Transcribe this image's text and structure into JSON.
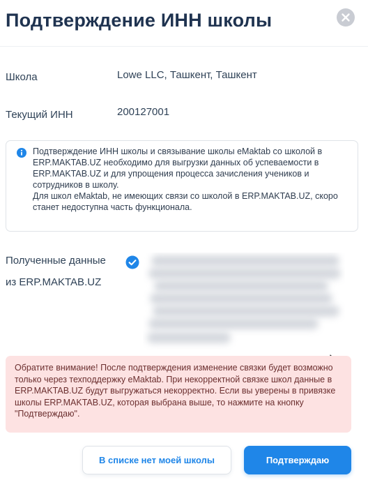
{
  "dialog": {
    "title": "Подтверждение ИНН школы",
    "close_icon": "close-icon"
  },
  "fields": {
    "school": {
      "label": "Школа",
      "value": "Lowe LLC, Ташкент, Ташкент"
    },
    "inn": {
      "label": "Текущий ИНН",
      "value": "200127001"
    },
    "received": {
      "label": "Полученные данные из ERP.MAKTAB.UZ",
      "status_icon": "check-circle-icon"
    }
  },
  "info": {
    "icon": "info-icon",
    "paragraph1": "Подтверждение ИНН школы и связывание школы eMaktab со школой в ERP.MAKTAB.UZ необходимо для выгрузки данных об успеваемости в ERP.MAKTAB.UZ и для упрощения процесса зачисления учеников и сотрудников в школу.",
    "paragraph2": "Для школ eMaktab, не имеющих связи со школой в ERP.MAKTAB.UZ, скоро станет недоступна часть функционала."
  },
  "warning": {
    "text": "Обратите внимание! После подтверждения изменение связки будет возможно только через техподдержку eMaktab. При некорректной связке школ данные в ERP.MAKTAB.UZ будут выгружаться некорректно. Если вы уверены в привязке школы ERP.MAKTAB.UZ, которая выбрана выше, то нажмите на кнопку \"Подтверждаю\"."
  },
  "buttons": {
    "not_in_list": "В списке нет моей школы",
    "confirm": "Подтверждаю"
  },
  "colors": {
    "accent": "#1f86e8",
    "title": "#1f3350",
    "warning_bg": "#fde2e2",
    "close_bg": "#c9ccd3"
  }
}
